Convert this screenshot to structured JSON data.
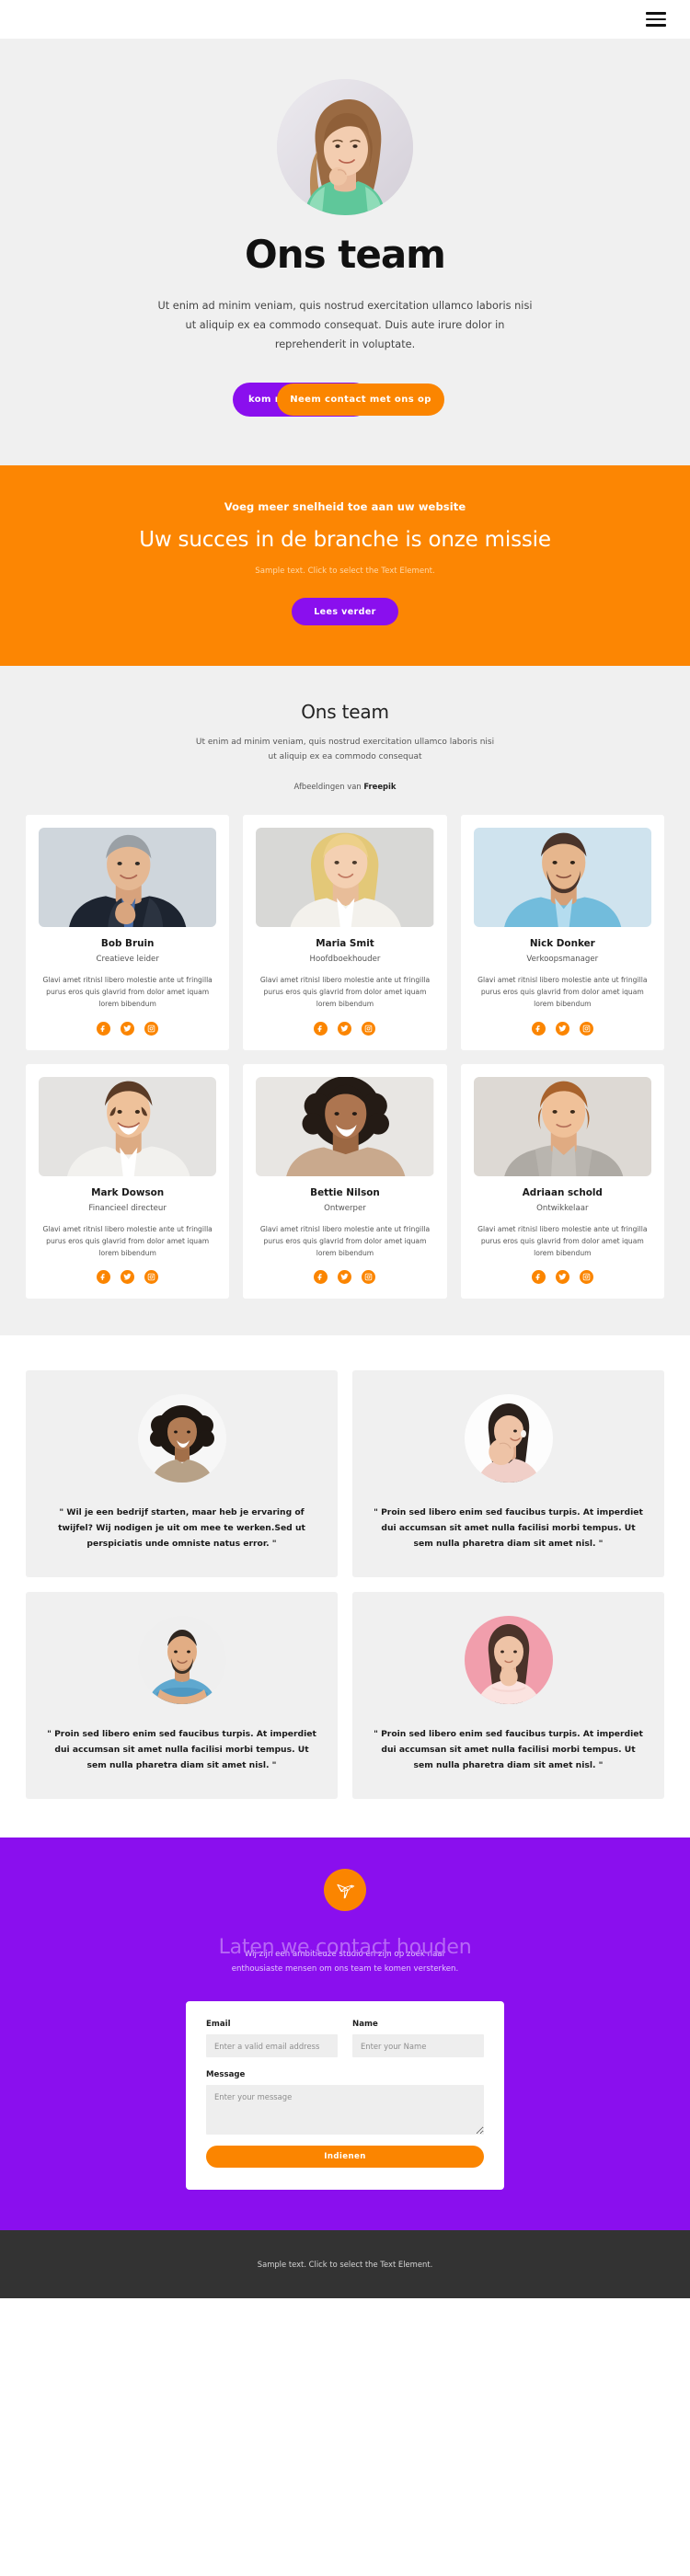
{
  "header": {
    "menu_icon": "hamburger-menu-icon"
  },
  "hero": {
    "title": "Ons team",
    "paragraph": "Ut enim ad minim veniam, quis nostrud exercitation ullamco laboris nisi ut aliquip ex ea commodo consequat. Duis aute irure dolor in reprehenderit in voluptate.",
    "primary_button": "kom meer te weten",
    "secondary_button": "Neem contact met ons op"
  },
  "banner": {
    "eyebrow": "Voeg meer snelheid toe aan uw website",
    "title": "Uw succes in de branche is onze missie",
    "sample": "Sample text. Click to select the Text Element.",
    "button": "Lees verder",
    "bg_color": "#FC8603",
    "button_color": "#8A0FEE"
  },
  "team": {
    "title": "Ons team",
    "subtitle": "Ut enim ad minim veniam, quis nostrud exercitation ullamco laboris nisi ut aliquip ex ea commodo consequat",
    "credit_prefix": "Afbeeldingen van ",
    "credit_brand": "Freepik",
    "bio": "Glavi amet ritnisl libero molestie ante ut fringilla purus eros quis glavrid from dolor amet iquam lorem bibendum",
    "members": [
      {
        "name": "Bob Bruin",
        "role": "Creatieve leider"
      },
      {
        "name": "Maria Smit",
        "role": "Hoofdboekhouder"
      },
      {
        "name": "Nick Donker",
        "role": "Verkoopsmanager"
      },
      {
        "name": "Mark Dowson",
        "role": "Financieel directeur"
      },
      {
        "name": "Bettie Nilson",
        "role": "Ontwerper"
      },
      {
        "name": "Adriaan schold",
        "role": "Ontwikkelaar"
      }
    ],
    "social_icons": [
      "facebook-icon",
      "twitter-icon",
      "instagram-icon"
    ],
    "social_color": "#FB8500"
  },
  "testimonials": [
    {
      "quote": "\" Wil je een bedrijf starten, maar heb je ervaring of twijfel? Wij nodigen je uit om mee te werken.Sed ut perspiciatis unde omniste natus error. \""
    },
    {
      "quote": "\" Proin sed libero enim sed faucibus turpis. At imperdiet dui accumsan sit amet nulla facilisi morbi tempus. Ut sem nulla pharetra diam sit amet nisl. \""
    },
    {
      "quote": "\" Proin sed libero enim sed faucibus turpis. At imperdiet dui accumsan sit amet nulla facilisi morbi tempus. Ut sem nulla pharetra diam sit amet nisl. \""
    },
    {
      "quote": "\" Proin sed libero enim sed faucibus turpis. At imperdiet dui accumsan sit amet nulla facilisi morbi tempus. Ut sem nulla pharetra diam sit amet nisl. \""
    }
  ],
  "contact": {
    "logo_icon": "origami-bird-icon",
    "title": "Laten we contact houden",
    "intro": "Wij zijn een ambitieuze studio en zijn op zoek naar enthousiaste mensen om ons team te komen versterken.",
    "bg_color": "#8A0FEE",
    "form": {
      "email_label": "Email",
      "email_placeholder": "Enter a valid email address",
      "email_value": "",
      "name_label": "Name",
      "name_placeholder": "Enter your Name",
      "name_value": "",
      "message_label": "Message",
      "message_placeholder": "Enter your message",
      "message_value": "",
      "submit_label": "Indienen",
      "submit_color": "#FB8500"
    }
  },
  "footer": {
    "text": "Sample text. Click to select the Text Element."
  }
}
